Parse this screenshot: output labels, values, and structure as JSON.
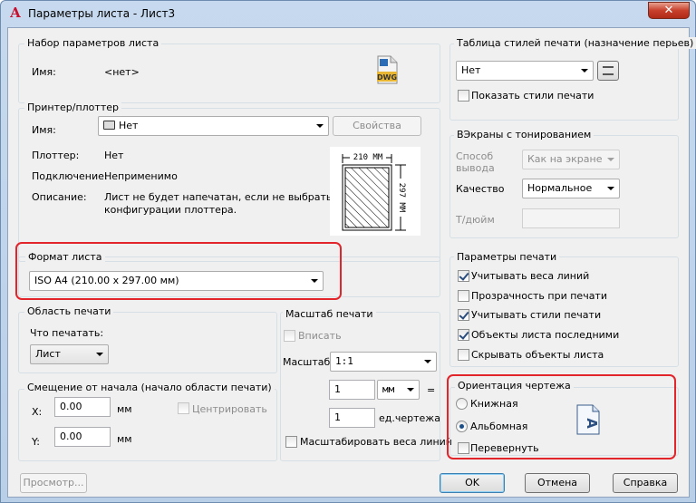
{
  "window": {
    "title": "Параметры листа - Лист3",
    "close": "✕"
  },
  "page_setup": {
    "title": "Набор параметров листа",
    "name_label": "Имя:",
    "name_value": "<нет>",
    "dwg_icon_text": "DWG"
  },
  "printer": {
    "title": "Принтер/плоттер",
    "name_label": "Имя:",
    "name_value": "Нет",
    "properties_button": "Свойства",
    "plotter_label": "Плоттер:",
    "plotter_value": "Нет",
    "connection_label": "Подключение:",
    "connection_value": "Неприменимо",
    "description_label": "Описание:",
    "description_line1": "Лист не будет напечатан, если не выбрать имя",
    "description_line2": "конфигурации плоттера.",
    "preview_width": "210 ММ",
    "preview_height": "297 ММ"
  },
  "paper_size": {
    "title": "Формат листа",
    "value": "ISO A4 (210.00 x 297.00 мм)"
  },
  "plot_area": {
    "title": "Область печати",
    "what_label": "Что печатать:",
    "what_value": "Лист"
  },
  "plot_offset": {
    "title": "Смещение от начала (начало области печати)",
    "x_label": "X:",
    "x_value": "0.00",
    "x_unit": "мм",
    "y_label": "Y:",
    "y_value": "0.00",
    "y_unit": "мм",
    "center_label": "Центрировать"
  },
  "plot_scale": {
    "title": "Масштаб печати",
    "fit_label": "Вписать",
    "scale_label": "Масштаб:",
    "scale_value": "1:1",
    "value1": "1",
    "unit_value": "мм",
    "equals": "=",
    "value2": "1",
    "unit2_label": "ед.чертежа",
    "lineweights_label": "Масштабировать веса линий"
  },
  "plot_style": {
    "title": "Таблица стилей печати (назначение перьев)",
    "value": "Нет",
    "show_label": "Показать стили печати"
  },
  "shaded_viewport": {
    "title": "ВЭкраны с тонированием",
    "shade_label_line1": "Способ",
    "shade_label_line2": "вывода",
    "shade_value": "Как на экране",
    "quality_label": "Качество",
    "quality_value": "Нормальное",
    "dpi_label": "Т/дюйм",
    "dpi_value": ""
  },
  "plot_options": {
    "title": "Параметры печати",
    "items": [
      {
        "label": "Учитывать веса линий",
        "checked": true
      },
      {
        "label": "Прозрачность при печати",
        "checked": false
      },
      {
        "label": "Учитывать стили печати",
        "checked": true
      },
      {
        "label": "Объекты листа последними",
        "checked": true
      },
      {
        "label": "Скрывать объекты листа",
        "checked": false
      }
    ]
  },
  "orientation": {
    "title": "Ориентация чертежа",
    "portrait": "Книжная",
    "landscape": "Альбомная",
    "upside_down": "Перевернуть",
    "selected": "landscape",
    "icon_letter": "A"
  },
  "buttons": {
    "preview": "Просмотр...",
    "ok": "OK",
    "cancel": "Отмена",
    "help": "Справка"
  },
  "colors": {
    "highlight": "#e2252b",
    "dwg_blue": "#2d6db5"
  }
}
